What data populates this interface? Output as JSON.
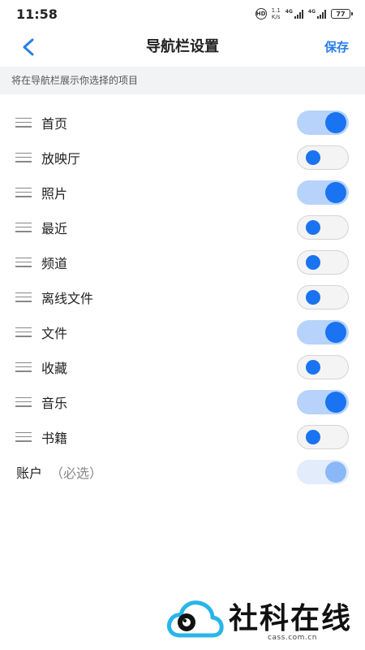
{
  "status_bar": {
    "time": "11:58",
    "speed_value": "1.1",
    "speed_unit": "K/s",
    "signal1_label": "4G",
    "signal2_label": "4G",
    "battery": "77",
    "hd_label": "HD"
  },
  "header": {
    "title": "导航栏设置",
    "save_label": "保存"
  },
  "hint": "将在导航栏展示你选择的项目",
  "items": [
    {
      "label": "首页",
      "enabled": true
    },
    {
      "label": "放映厅",
      "enabled": false
    },
    {
      "label": "照片",
      "enabled": true
    },
    {
      "label": "最近",
      "enabled": false
    },
    {
      "label": "频道",
      "enabled": false
    },
    {
      "label": "离线文件",
      "enabled": false
    },
    {
      "label": "文件",
      "enabled": true
    },
    {
      "label": "收藏",
      "enabled": false
    },
    {
      "label": "音乐",
      "enabled": true
    },
    {
      "label": "书籍",
      "enabled": false
    }
  ],
  "account": {
    "label": "账户",
    "note": "（必选）",
    "enabled": true
  },
  "watermark": {
    "text": "社科在线",
    "url": "cass.com.cn"
  },
  "colors": {
    "accent": "#2b7de9",
    "knob": "#1a73f0",
    "track_on": "#b7d3fb",
    "track_disabled": "#e2ecfb",
    "hint_bg": "#f2f3f5",
    "watermark_logo": "#29b5ea"
  }
}
